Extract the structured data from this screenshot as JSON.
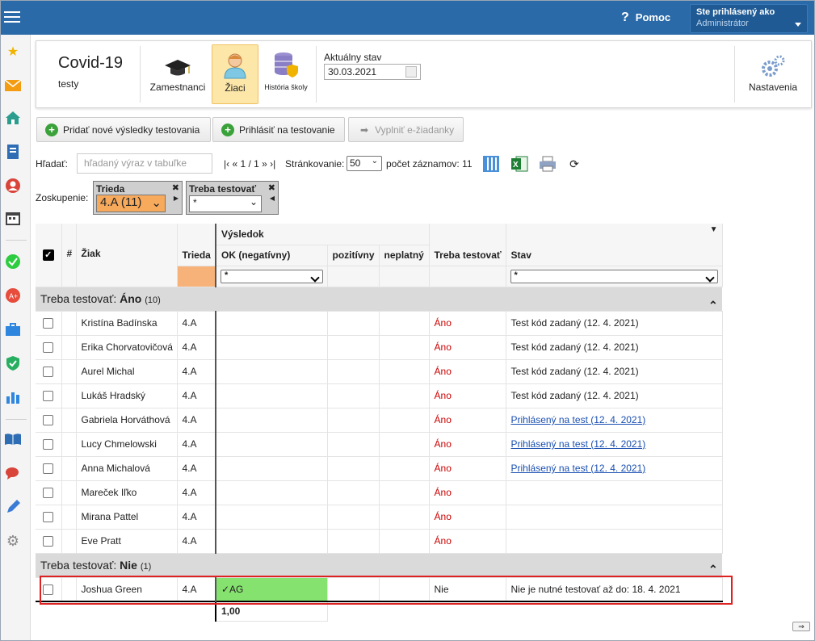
{
  "header": {
    "help_label": "Pomoc",
    "user_label": "Ste prihlásený ako",
    "user_value": "Administrátor"
  },
  "toolbar": {
    "title": "Covid-19",
    "subtitle": "testy",
    "employees_label": "Zamestnanci",
    "students_label": "Žiaci",
    "history_label": "História školy",
    "state_label": "Aktuálny stav",
    "state_date": "30.03.2021",
    "settings_label": "Nastavenia"
  },
  "actions": {
    "add_results": "Pridať nové výsledky testovania",
    "register": "Prihlásiť na testovanie",
    "fill_requests": "Vyplniť e-žiadanky"
  },
  "filters": {
    "search_label": "Hľadať:",
    "search_placeholder": "hľadaný výraz v tabuľke",
    "pager_text": "|‹ « 1 / 1 » ›|",
    "paging_label": "Stránkovanie:",
    "paging_value": "50",
    "count_label": "počet záznamov: 11",
    "group_label": "Zoskupenie:",
    "group1_title": "Trieda",
    "group1_value": "4.A (11)",
    "group2_title": "Treba testovať",
    "group2_value": "*"
  },
  "table": {
    "headers": {
      "num": "#",
      "student": "Žiak",
      "class": "Trieda",
      "result": "Výsledok",
      "ok": "OK (negatívny)",
      "positive": "pozitívny",
      "invalid": "neplatný",
      "need_test": "Treba testovať",
      "status": "Stav"
    },
    "filter_ok": "*",
    "filter_status": "*",
    "group1": {
      "prefix": "Treba testovať:",
      "value": "Áno",
      "count": "(10)"
    },
    "group2": {
      "prefix": "Treba testovať:",
      "value": "Nie",
      "count": "(1)"
    },
    "rows": [
      {
        "name": "Kristína Badínska",
        "cls": "4.A",
        "need": "Áno",
        "status": "Test kód zadaný (12. 4. 2021)",
        "link": false
      },
      {
        "name": "Erika Chorvatovičová",
        "cls": "4.A",
        "need": "Áno",
        "status": "Test kód zadaný (12. 4. 2021)",
        "link": false
      },
      {
        "name": "Aurel Michal",
        "cls": "4.A",
        "need": "Áno",
        "status": "Test kód zadaný (12. 4. 2021)",
        "link": false
      },
      {
        "name": "Lukáš Hradský",
        "cls": "4.A",
        "need": "Áno",
        "status": "Test kód zadaný (12. 4. 2021)",
        "link": false
      },
      {
        "name": "Gabriela Horváthová",
        "cls": "4.A",
        "need": "Áno",
        "status": "Prihlásený na test (12. 4. 2021)",
        "link": true
      },
      {
        "name": "Lucy Chmelowski",
        "cls": "4.A",
        "need": "Áno",
        "status": "Prihlásený na test (12. 4. 2021)",
        "link": true
      },
      {
        "name": "Anna Michalová",
        "cls": "4.A",
        "need": "Áno",
        "status": "Prihlásený na test (12. 4. 2021)",
        "link": true
      },
      {
        "name": "Mareček Iľko",
        "cls": "4.A",
        "need": "Áno",
        "status": "",
        "link": false
      },
      {
        "name": "Mirana Pattel",
        "cls": "4.A",
        "need": "Áno",
        "status": "",
        "link": false
      },
      {
        "name": "Eve Pratt",
        "cls": "4.A",
        "need": "Áno",
        "status": "",
        "link": false
      }
    ],
    "last_row": {
      "name": "Joshua Green",
      "cls": "4.A",
      "ok": "✓AG",
      "need": "Nie",
      "status": "Nie je nutné testovať až do: 18. 4. 2021"
    },
    "footer_value": "1,00"
  }
}
